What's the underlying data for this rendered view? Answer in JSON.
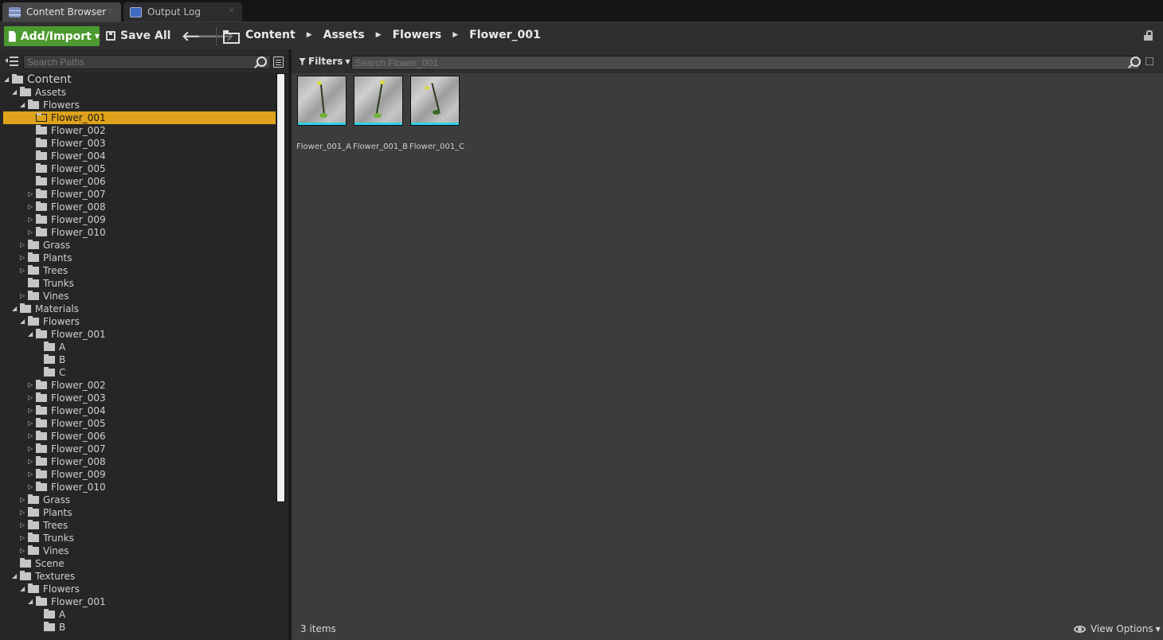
{
  "tabs": [
    {
      "label": "Content Browser",
      "icon": "content-browser-icon",
      "close": "×"
    },
    {
      "label": "Output Log",
      "icon": "output-log-icon",
      "close": "×"
    }
  ],
  "toolbar": {
    "add_import_label": "Add/Import",
    "save_all_label": "Save All",
    "breadcrumb": [
      "Content",
      "Assets",
      "Flowers",
      "Flower_001"
    ]
  },
  "paths": {
    "search_placeholder": "Search Paths",
    "tree": [
      {
        "label": "Content",
        "depth": 0,
        "arrow": "open"
      },
      {
        "label": "Assets",
        "depth": 1,
        "arrow": "open"
      },
      {
        "label": "Flowers",
        "depth": 2,
        "arrow": "open"
      },
      {
        "label": "Flower_001",
        "depth": 3,
        "arrow": "none",
        "selected": true
      },
      {
        "label": "Flower_002",
        "depth": 3,
        "arrow": "none"
      },
      {
        "label": "Flower_003",
        "depth": 3,
        "arrow": "none"
      },
      {
        "label": "Flower_004",
        "depth": 3,
        "arrow": "none"
      },
      {
        "label": "Flower_005",
        "depth": 3,
        "arrow": "none"
      },
      {
        "label": "Flower_006",
        "depth": 3,
        "arrow": "none"
      },
      {
        "label": "Flower_007",
        "depth": 3,
        "arrow": "closed"
      },
      {
        "label": "Flower_008",
        "depth": 3,
        "arrow": "closed"
      },
      {
        "label": "Flower_009",
        "depth": 3,
        "arrow": "closed"
      },
      {
        "label": "Flower_010",
        "depth": 3,
        "arrow": "closed"
      },
      {
        "label": "Grass",
        "depth": 2,
        "arrow": "closed"
      },
      {
        "label": "Plants",
        "depth": 2,
        "arrow": "closed"
      },
      {
        "label": "Trees",
        "depth": 2,
        "arrow": "closed"
      },
      {
        "label": "Trunks",
        "depth": 2,
        "arrow": "none"
      },
      {
        "label": "Vines",
        "depth": 2,
        "arrow": "closed"
      },
      {
        "label": "Materials",
        "depth": 1,
        "arrow": "open"
      },
      {
        "label": "Flowers",
        "depth": 2,
        "arrow": "open"
      },
      {
        "label": "Flower_001",
        "depth": 3,
        "arrow": "open"
      },
      {
        "label": "A",
        "depth": 4,
        "arrow": "none"
      },
      {
        "label": "B",
        "depth": 4,
        "arrow": "none"
      },
      {
        "label": "C",
        "depth": 4,
        "arrow": "none"
      },
      {
        "label": "Flower_002",
        "depth": 3,
        "arrow": "closed"
      },
      {
        "label": "Flower_003",
        "depth": 3,
        "arrow": "closed"
      },
      {
        "label": "Flower_004",
        "depth": 3,
        "arrow": "closed"
      },
      {
        "label": "Flower_005",
        "depth": 3,
        "arrow": "closed"
      },
      {
        "label": "Flower_006",
        "depth": 3,
        "arrow": "closed"
      },
      {
        "label": "Flower_007",
        "depth": 3,
        "arrow": "closed"
      },
      {
        "label": "Flower_008",
        "depth": 3,
        "arrow": "closed"
      },
      {
        "label": "Flower_009",
        "depth": 3,
        "arrow": "closed"
      },
      {
        "label": "Flower_010",
        "depth": 3,
        "arrow": "closed"
      },
      {
        "label": "Grass",
        "depth": 2,
        "arrow": "closed"
      },
      {
        "label": "Plants",
        "depth": 2,
        "arrow": "closed"
      },
      {
        "label": "Trees",
        "depth": 2,
        "arrow": "closed"
      },
      {
        "label": "Trunks",
        "depth": 2,
        "arrow": "closed"
      },
      {
        "label": "Vines",
        "depth": 2,
        "arrow": "closed"
      },
      {
        "label": "Scene",
        "depth": 1,
        "arrow": "none"
      },
      {
        "label": "Textures",
        "depth": 1,
        "arrow": "open"
      },
      {
        "label": "Flowers",
        "depth": 2,
        "arrow": "open"
      },
      {
        "label": "Flower_001",
        "depth": 3,
        "arrow": "open"
      },
      {
        "label": "A",
        "depth": 4,
        "arrow": "none"
      },
      {
        "label": "B",
        "depth": 4,
        "arrow": "none"
      }
    ]
  },
  "assets": {
    "filters_label": "Filters",
    "search_placeholder": "Search Flower_001",
    "items": [
      {
        "label": "Flower_001_A"
      },
      {
        "label": "Flower_001_B"
      },
      {
        "label": "Flower_001_C"
      }
    ],
    "count_label": "3 items",
    "view_options_label": "View Options"
  },
  "colors": {
    "selection": "#dea21b",
    "add_button": "#4c9a2f",
    "thumbnail_bar": "#2fd2e6"
  }
}
